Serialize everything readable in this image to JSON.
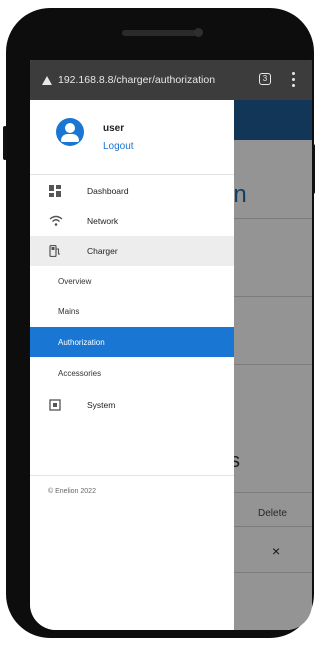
{
  "browser": {
    "url": "192.168.8.8/charger/authorization",
    "tab_count": "3",
    "warning_icon": "not-secure-warning-icon"
  },
  "page": {
    "title_fragment": "on",
    "sub_fragment": "s",
    "column_header": "Delete",
    "delete_symbol": "×",
    "header_color": "#1f5e96"
  },
  "drawer": {
    "user": {
      "name": "user",
      "logout_label": "Logout"
    },
    "nav": [
      {
        "label": "Dashboard",
        "icon": "dashboard-icon"
      },
      {
        "label": "Network",
        "icon": "wifi-icon"
      },
      {
        "label": "Charger",
        "icon": "charger-icon"
      }
    ],
    "charger_sub": [
      {
        "label": "Overview"
      },
      {
        "label": "Mains"
      },
      {
        "label": "Authorization",
        "selected": true
      },
      {
        "label": "Accessories"
      }
    ],
    "system": {
      "label": "System",
      "icon": "cpu-icon"
    },
    "copyright": "© Enelion 2022"
  },
  "colors": {
    "accent": "#1976d2",
    "selected_bg": "#1976d2",
    "charger_bg": "#ededed",
    "overlay": "rgba(0,0,0,0.42)"
  }
}
